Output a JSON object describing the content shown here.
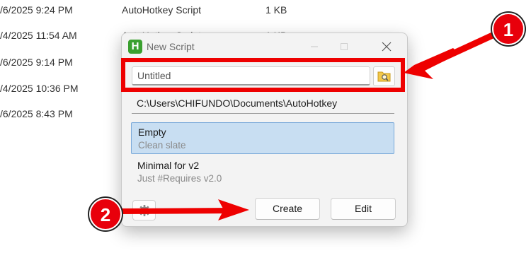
{
  "background_rows": [
    {
      "date": "/6/2025 9:24 PM",
      "type": "AutoHotkey Script",
      "size": "1 KB"
    },
    {
      "date": "/4/2025 11:54 AM",
      "type": "AutoHotkey Script",
      "size": "1 KB"
    },
    {
      "date": "/6/2025 9:14 PM",
      "type": "",
      "size": ""
    },
    {
      "date": "/4/2025 10:36 PM",
      "type": "",
      "size": ""
    },
    {
      "date": "/6/2025 8:43 PM",
      "type": "",
      "size": ""
    }
  ],
  "dialog": {
    "app_icon_letter": "H",
    "title": "New Script",
    "name_input": {
      "value": "Untitled"
    },
    "path": "C:\\Users\\CHIFUNDO\\Documents\\AutoHotkey",
    "templates": [
      {
        "name": "Empty",
        "description": "Clean slate",
        "selected": true
      },
      {
        "name": "Minimal for v2",
        "description": "Just #Requires v2.0",
        "selected": false
      }
    ],
    "create_label": "Create",
    "edit_label": "Edit"
  },
  "annotations": {
    "badge_1": "1",
    "badge_2": "2",
    "color": "#ee0000"
  },
  "icons": {
    "browse": "folder-search-icon",
    "settings": "gear-icon",
    "minimize": "minimize-icon",
    "maximize": "maximize-icon",
    "close": "close-icon"
  }
}
